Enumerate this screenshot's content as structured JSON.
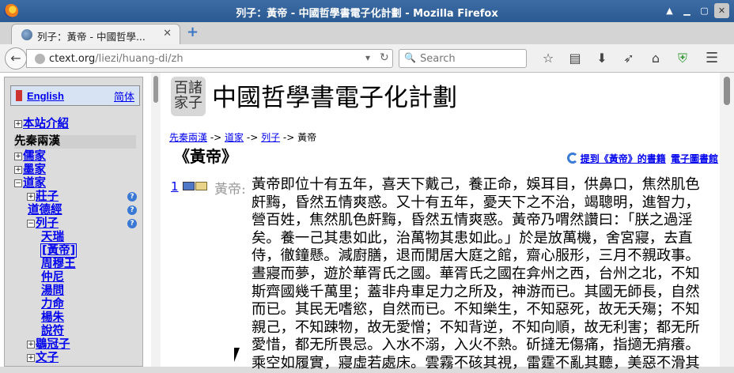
{
  "window": {
    "title": "列子：黃帝 - 中國哲學書電子化計劃 - Mozilla Firefox"
  },
  "tab": {
    "title": "列子：黃帝 - 中國哲學..."
  },
  "nav": {
    "url_host": "ctext.org",
    "url_path": "/liezi/huang-di/zh",
    "search_placeholder": "Search"
  },
  "sidebar": {
    "english": "English",
    "simplified": "简体",
    "items": [
      {
        "label": "本站介紹",
        "pm": "+"
      },
      {
        "label": "先秦兩漢"
      },
      {
        "label": "儒家",
        "pm": "+"
      },
      {
        "label": "墨家",
        "pm": "+"
      },
      {
        "label": "道家",
        "pm": "−"
      },
      {
        "label": "莊子",
        "pm": "+"
      },
      {
        "label": "道德經"
      },
      {
        "label": "列子",
        "pm": "−"
      },
      {
        "label": "天瑞"
      },
      {
        "label": "[黃帝]"
      },
      {
        "label": "周穆王"
      },
      {
        "label": "仲尼"
      },
      {
        "label": "湯問"
      },
      {
        "label": "力命"
      },
      {
        "label": "楊朱"
      },
      {
        "label": "說符"
      },
      {
        "label": "鶡冠子",
        "pm": "+"
      },
      {
        "label": "文子",
        "pm": "+"
      }
    ]
  },
  "main": {
    "logo_line1": "百諸",
    "logo_line2": "家子",
    "site_title": "中國哲學書電子化計劃",
    "crumbs": [
      "先秦兩漢",
      "道家",
      "列子",
      "黃帝"
    ],
    "crumb_sep": " -> ",
    "page_title": "《黃帝》",
    "link_books": "提到《黃帝》的書籍",
    "link_library": "電子圖書館",
    "paragraph_number": "1",
    "speaker": "黃帝:",
    "lines": [
      "黃帝即位十有五年，喜天下戴己，養正命，娛耳目，供鼻口，焦然肌色",
      "皯黣，昏然五情爽惑。又十有五年，憂天下之不治，竭聰明，進智力，",
      "營百姓，焦然肌色皯黣，昏然五情爽惑。黃帝乃喟然讚曰：「朕之過淫",
      "矣。養一己其患如此，治萬物其患如此。」於是放萬機，舍宮寢，去直",
      "侍，徹鐘懸。減廚膳，退而閒居大庭之館，齋心服形，三月不親政事。",
      "晝寢而夢，遊於華胥氏之國。華胥氏之國在弇州之西，台州之北，不知",
      "斯齊國幾千萬里；蓋非舟車足力之所及，神游而已。其國无師長，自然",
      "而已。其民无嗜慾，自然而已。不知樂生，不知惡死，故无夭殤；不知",
      "親己，不知踈物，故无愛憎；不知背逆，不知向順，故无利害；都无所",
      "愛惜，都无所畏忌。入水不溺，入火不熱。斫撻无傷痛，指擿无痟癢。",
      "乘空如履實，寢虛若處床。雲霧不硋其視，雷霆不亂其聽，美惡不滑其"
    ]
  }
}
